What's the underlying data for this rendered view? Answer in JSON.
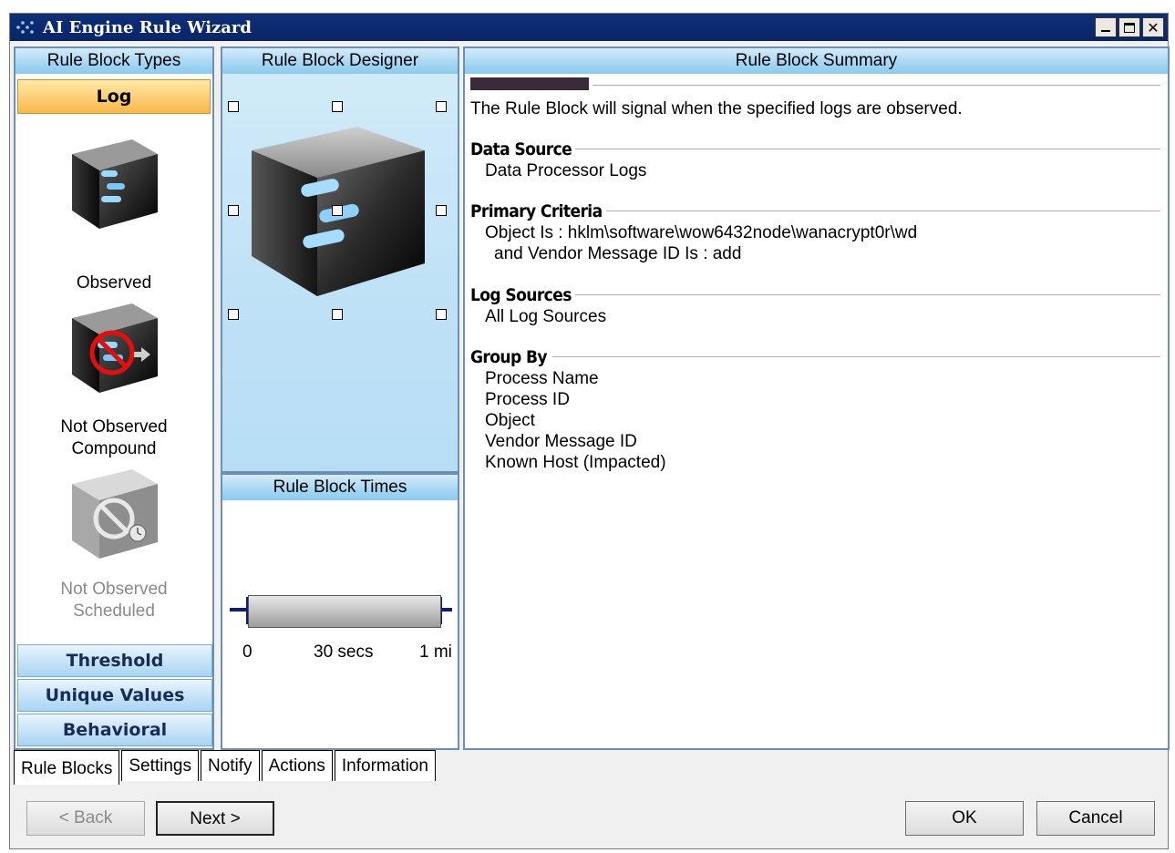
{
  "window": {
    "title": "AI Engine Rule Wizard",
    "controls": [
      "minimize",
      "maximize",
      "close"
    ]
  },
  "types_panel": {
    "header": "Rule Block Types",
    "selected_category": "Log",
    "items": [
      {
        "label": "Observed",
        "enabled": true,
        "icon": "log-observed-cube-icon"
      },
      {
        "label": "Not Observed Compound",
        "line1": "Not Observed",
        "line2": "Compound",
        "enabled": true,
        "icon": "log-not-observed-compound-cube-icon"
      },
      {
        "label": "Not Observed Scheduled",
        "line1": "Not Observed",
        "line2": "Scheduled",
        "enabled": false,
        "icon": "log-not-observed-scheduled-cube-icon"
      }
    ],
    "categories": [
      "Threshold",
      "Unique Values",
      "Behavioral"
    ]
  },
  "designer_panel": {
    "header": "Rule Block Designer"
  },
  "times_panel": {
    "header": "Rule Block Times",
    "ticks": [
      "0",
      "30 secs",
      "1 mi"
    ]
  },
  "summary_panel": {
    "header": "Rule Block Summary",
    "description": "The Rule Block will signal when the specified logs are observed.",
    "sections": [
      {
        "title": "Data Source",
        "lines": [
          "Data Processor Logs"
        ]
      },
      {
        "title": "Primary Criteria",
        "lines": [
          "Object Is : hklm\\software\\wow6432node\\wanacrypt0r\\wd",
          "and Vendor Message ID Is : add"
        ]
      },
      {
        "title": "Log Sources",
        "lines": [
          "All Log Sources"
        ]
      },
      {
        "title": "Group By",
        "lines": [
          "Process Name",
          "Process ID",
          "Object",
          "Vendor Message ID",
          "Known Host (Impacted)"
        ]
      }
    ]
  },
  "tabs": [
    "Rule Blocks",
    "Settings",
    "Notify",
    "Actions",
    "Information"
  ],
  "active_tab": "Rule Blocks",
  "buttons": {
    "back": "< Back",
    "next": "Next >",
    "ok": "OK",
    "cancel": "Cancel"
  }
}
